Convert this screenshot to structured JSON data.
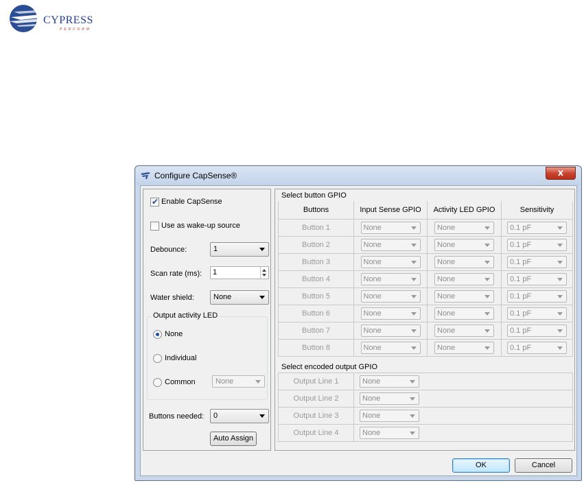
{
  "brand": {
    "name": "CYPRESS",
    "tagline": "PERFORM"
  },
  "window": {
    "title": "Configure CapSense®",
    "close_glyph": "x"
  },
  "left": {
    "enable_capsense": {
      "label": "Enable CapSense",
      "checked": true
    },
    "wakeup": {
      "label": "Use as wake-up source",
      "checked": false
    },
    "debounce": {
      "label": "Debounce:",
      "value": "1"
    },
    "scan_rate": {
      "label": "Scan rate (ms):",
      "value": "1"
    },
    "water_shield": {
      "label": "Water shield:",
      "value": "None"
    },
    "output_led": {
      "title": "Output activity LED",
      "options": [
        "None",
        "Individual",
        "Common"
      ],
      "selected": "None",
      "common_value": "None"
    },
    "buttons_needed": {
      "label": "Buttons needed:",
      "value": "0"
    },
    "auto_assign": "Auto Assign"
  },
  "button_gpio": {
    "title": "Select button GPIO",
    "headers": [
      "Buttons",
      "Input Sense GPIO",
      "Activity LED GPIO",
      "Sensitivity"
    ],
    "rows": [
      {
        "name": "Button 1",
        "input": "None",
        "led": "None",
        "sens": "0.1 pF"
      },
      {
        "name": "Button 2",
        "input": "None",
        "led": "None",
        "sens": "0.1 pF"
      },
      {
        "name": "Button 3",
        "input": "None",
        "led": "None",
        "sens": "0.1 pF"
      },
      {
        "name": "Button 4",
        "input": "None",
        "led": "None",
        "sens": "0.1 pF"
      },
      {
        "name": "Button 5",
        "input": "None",
        "led": "None",
        "sens": "0.1 pF"
      },
      {
        "name": "Button 6",
        "input": "None",
        "led": "None",
        "sens": "0.1 pF"
      },
      {
        "name": "Button 7",
        "input": "None",
        "led": "None",
        "sens": "0.1 pF"
      },
      {
        "name": "Button 8",
        "input": "None",
        "led": "None",
        "sens": "0.1 pF"
      }
    ]
  },
  "encoded_gpio": {
    "title": "Select encoded output GPIO",
    "rows": [
      {
        "name": "Output Line 1",
        "value": "None"
      },
      {
        "name": "Output Line 2",
        "value": "None"
      },
      {
        "name": "Output Line 3",
        "value": "None"
      },
      {
        "name": "Output Line 4",
        "value": "None"
      }
    ]
  },
  "footer": {
    "ok": "OK",
    "cancel": "Cancel"
  }
}
